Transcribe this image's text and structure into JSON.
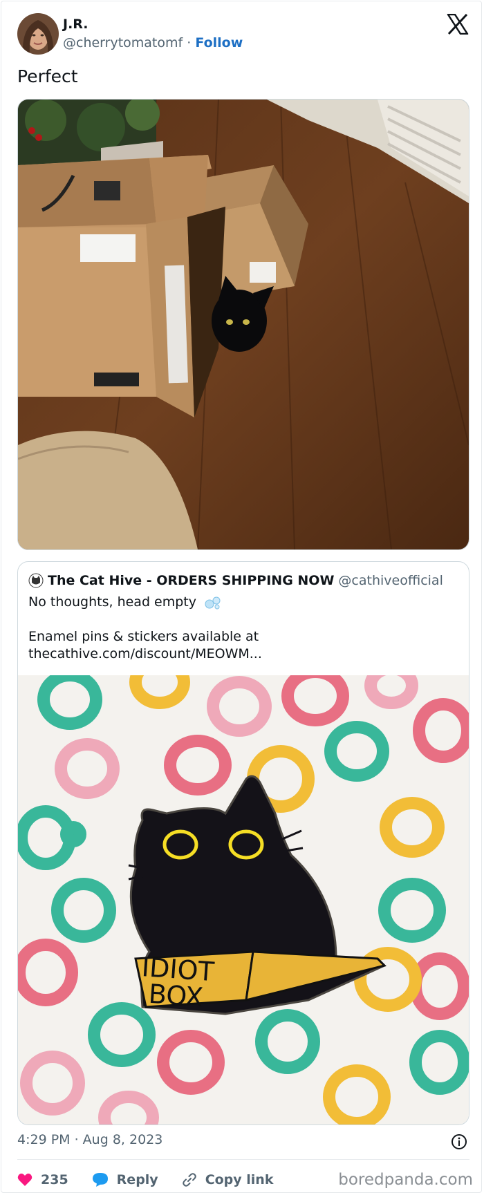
{
  "author": {
    "name": "J.R.",
    "handle": "@cherrytomatomf",
    "separator": "·",
    "follow_label": "Follow"
  },
  "tweet": {
    "text": "Perfect",
    "timestamp": "4:29 PM · Aug 8, 2023"
  },
  "quoted": {
    "name": "The Cat Hive - ORDERS SHIPPING NOW",
    "handle": "@cathiveofficial",
    "line1": "No thoughts, head empty",
    "line2": "Enamel pins & stickers available at",
    "line3": "thecathive.com/discount/MEOWM...",
    "pin_text_1": "IDIOT",
    "pin_text_2": "BOX"
  },
  "actions": {
    "like_count": "235",
    "reply_label": "Reply",
    "copy_link_label": "Copy link"
  },
  "watermark": "boredpanda.com",
  "colors": {
    "follow": "#1d6fc4",
    "heart": "#f91880",
    "reply_bubble": "#1d9bf0",
    "secondary_text": "#536471"
  },
  "icons": [
    "x-logo-icon",
    "info-icon",
    "heart-icon",
    "reply-bubble-icon",
    "link-icon",
    "bubbles-emoji-icon"
  ]
}
